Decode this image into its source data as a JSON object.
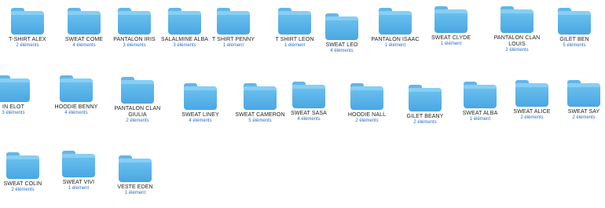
{
  "folders": [
    {
      "name": "T-SHIRT ALEX",
      "count": "2 éléments"
    },
    {
      "name": "SWEAT COME",
      "count": "4 éléments"
    },
    {
      "name": "PANTALON IRIS",
      "count": "3 éléments"
    },
    {
      "name": "SALALMINE ALBA",
      "count": "3 éléments"
    },
    {
      "name": "T SHIRT PENNY",
      "count": "1 élément"
    },
    {
      "name": "T SHIRT LEON",
      "count": "1 élément"
    },
    {
      "name": "SWEAT LEO",
      "count": "4 éléments"
    },
    {
      "name": "PANTALON ISAAC",
      "count": "1 élément"
    },
    {
      "name": "SWEAT CLYDE",
      "count": "1 élément"
    },
    {
      "name": "PANTALON CLAN LOUIS",
      "count": "2 éléments"
    },
    {
      "name": "GILET BEN",
      "count": "5 éléments"
    },
    {
      "name": "IN ELOT",
      "count": "3 éléments"
    },
    {
      "name": "HOODIE BENNY",
      "count": "4 éléments"
    },
    {
      "name": "PANTALON CLAN GIULIA",
      "count": "2 éléments"
    },
    {
      "name": "SWEAT LINEY",
      "count": "4 éléments"
    },
    {
      "name": "SWEAT CAMERON",
      "count": "5 éléments"
    },
    {
      "name": "SWEAT SASA",
      "count": "4 éléments"
    },
    {
      "name": "HOODIE NALL",
      "count": "2 éléments"
    },
    {
      "name": "GILET BEANY",
      "count": "2 éléments"
    },
    {
      "name": "SWEAT ALBA",
      "count": "1 élément"
    },
    {
      "name": "SWEAT ALICE",
      "count": "2 éléments"
    },
    {
      "name": "SWEAT SAY",
      "count": "2 éléments"
    },
    {
      "name": "SWEAT COLIN",
      "count": "2 éléments"
    },
    {
      "name": "SWEAT VIVI",
      "count": "1 élément"
    },
    {
      "name": "VESTE EDEN",
      "count": "1 élément"
    }
  ]
}
